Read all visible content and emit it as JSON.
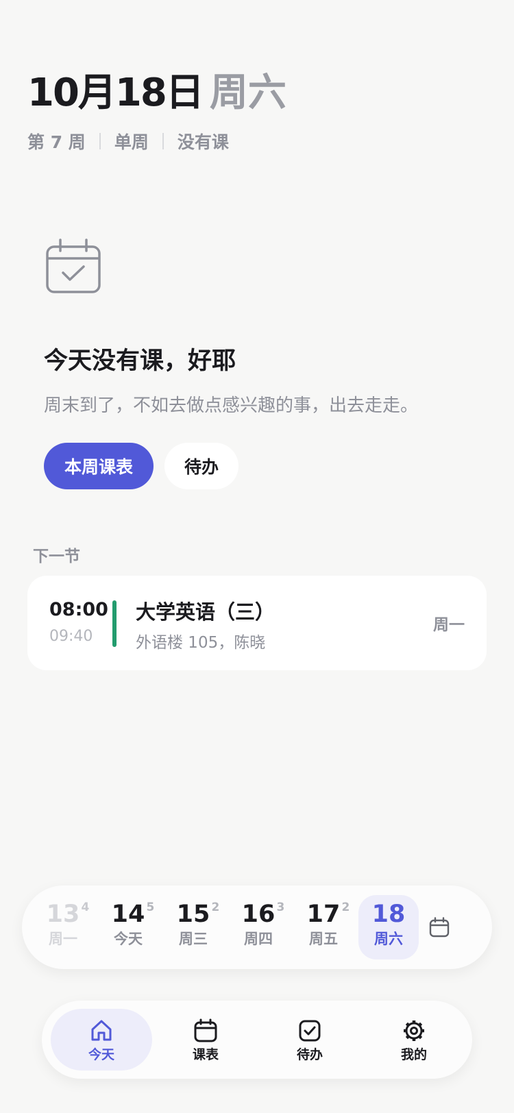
{
  "header": {
    "date": "10月18日",
    "weekday": "周六",
    "week_number": "第 7 周",
    "week_parity": "单周",
    "status": "没有课"
  },
  "empty_state": {
    "icon": "calendar-check-icon",
    "title": "今天没有课，好耶",
    "subtitle": "周末到了，不如去做点感兴趣的事，出去走走。",
    "primary_button": "本周课表",
    "secondary_button": "待办"
  },
  "next_class": {
    "section_label": "下一节",
    "start_time": "08:00",
    "end_time": "09:40",
    "course": "大学英语（三）",
    "location": "外语楼 105，陈晓",
    "day": "周一",
    "accent_color": "#239c6e"
  },
  "week_strip": {
    "days": [
      {
        "num": "13",
        "count": "4",
        "label": "周一",
        "state": "past"
      },
      {
        "num": "14",
        "count": "5",
        "label": "今天",
        "state": "normal"
      },
      {
        "num": "15",
        "count": "2",
        "label": "周三",
        "state": "normal"
      },
      {
        "num": "16",
        "count": "3",
        "label": "周四",
        "state": "normal"
      },
      {
        "num": "17",
        "count": "2",
        "label": "周五",
        "state": "normal"
      },
      {
        "num": "18",
        "count": "",
        "label": "周六",
        "state": "active"
      }
    ],
    "calendar_icon": "calendar-icon"
  },
  "bottom_nav": {
    "items": [
      {
        "label": "今天",
        "icon": "home-icon",
        "active": true
      },
      {
        "label": "课表",
        "icon": "calendar-icon",
        "active": false
      },
      {
        "label": "待办",
        "icon": "checkbox-icon",
        "active": false
      },
      {
        "label": "我的",
        "icon": "gear-icon",
        "active": false
      }
    ]
  },
  "colors": {
    "accent": "#5159d8",
    "accent_soft": "#ededfa",
    "background": "#f7f7f6",
    "muted_text": "#8e9099"
  }
}
